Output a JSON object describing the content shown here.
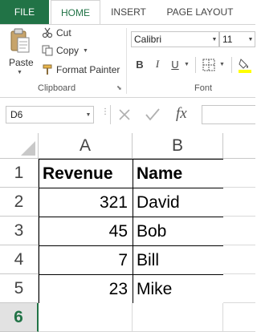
{
  "ribbon_tabs": {
    "file": "FILE",
    "home": "HOME",
    "insert": "INSERT",
    "page_layout": "PAGE LAYOUT"
  },
  "clipboard": {
    "paste": "Paste",
    "cut": "Cut",
    "copy": "Copy",
    "format_painter": "Format Painter",
    "group_label": "Clipboard"
  },
  "font": {
    "font_name": "Calibri",
    "font_size": "11",
    "bold": "B",
    "italic": "I",
    "underline": "U",
    "group_label": "Font"
  },
  "formula_bar": {
    "name_box": "D6",
    "function_icon": "fx",
    "value": ""
  },
  "sheet": {
    "columns": [
      "A",
      "B"
    ],
    "row_numbers": [
      "1",
      "2",
      "3",
      "4",
      "5",
      "6"
    ],
    "rows": [
      [
        "Revenue",
        "Name"
      ],
      [
        "321",
        "David"
      ],
      [
        "45",
        "Bob"
      ],
      [
        "7",
        "Bill"
      ],
      [
        "23",
        "Mike"
      ],
      [
        "",
        ""
      ]
    ]
  },
  "colors": {
    "accent": "#217346",
    "highlight_underline": "#ffff00"
  }
}
